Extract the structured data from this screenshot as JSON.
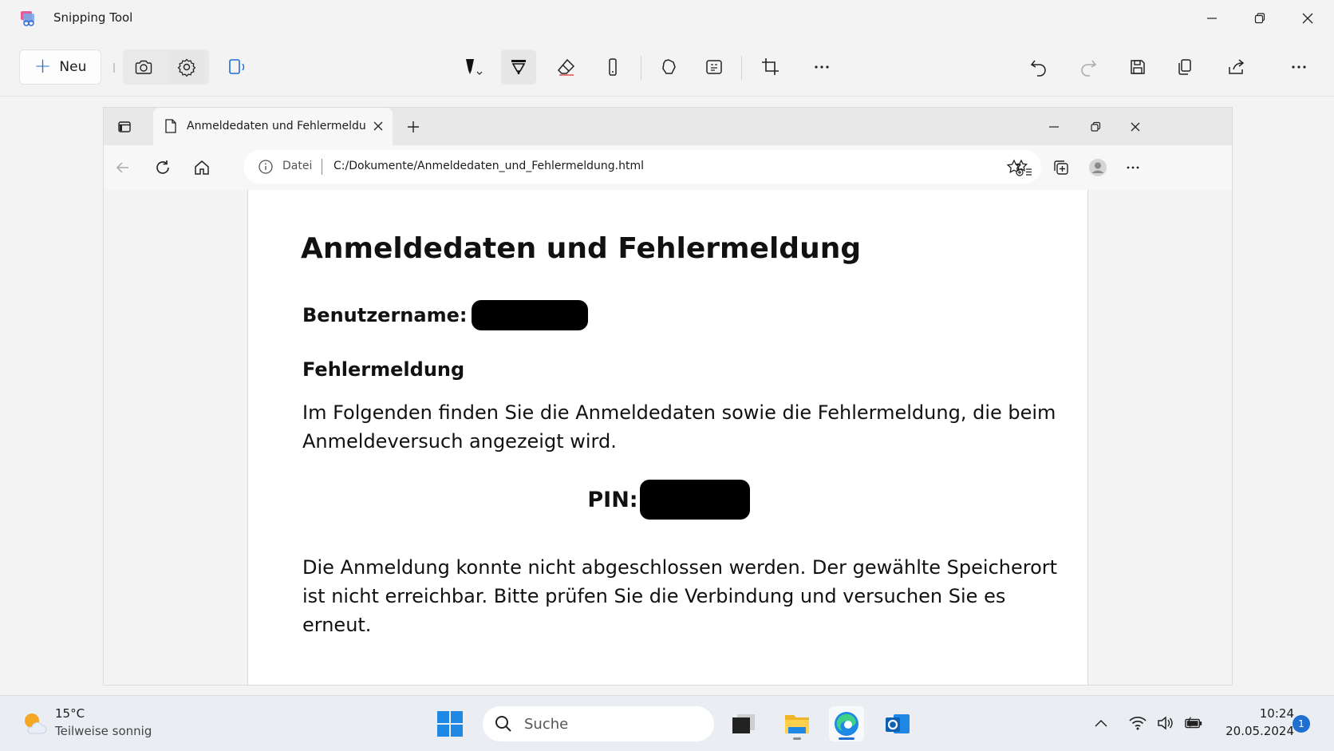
{
  "app": {
    "title": "Snipping Tool",
    "new_label": "Neu"
  },
  "browser": {
    "tab_title": "Anmeldedaten und Fehlermeldung",
    "address_scheme": "Datei",
    "address_url": "C:/Dokumente/Anmeldedaten_und_Fehlermeldung.html"
  },
  "document": {
    "title": "Anmeldedaten und Fehlermeldung",
    "username_label": "Benutzername:",
    "section_heading": "Fehlermeldung",
    "intro_text": "Im Folgenden finden Sie die Anmeldedaten sowie die Fehlermeldung, die beim Anmeldeversuch angezeigt wird.",
    "pin_label": "PIN:",
    "error_text": "Die Anmeldung konnte nicht abgeschlossen werden. Der gewählte Speicherort ist nicht erreichbar. Bitte prüfen Sie die Verbindung und versuchen Sie es erneut."
  },
  "taskbar": {
    "weather_temp": "15°C",
    "weather_desc": "Teilweise sonnig",
    "search_placeholder": "Suche",
    "time": "10:24",
    "date": "20.05.2024",
    "notification_count": "1"
  },
  "colors": {
    "accent": "#1f6fd1",
    "redaction": "#000000"
  }
}
